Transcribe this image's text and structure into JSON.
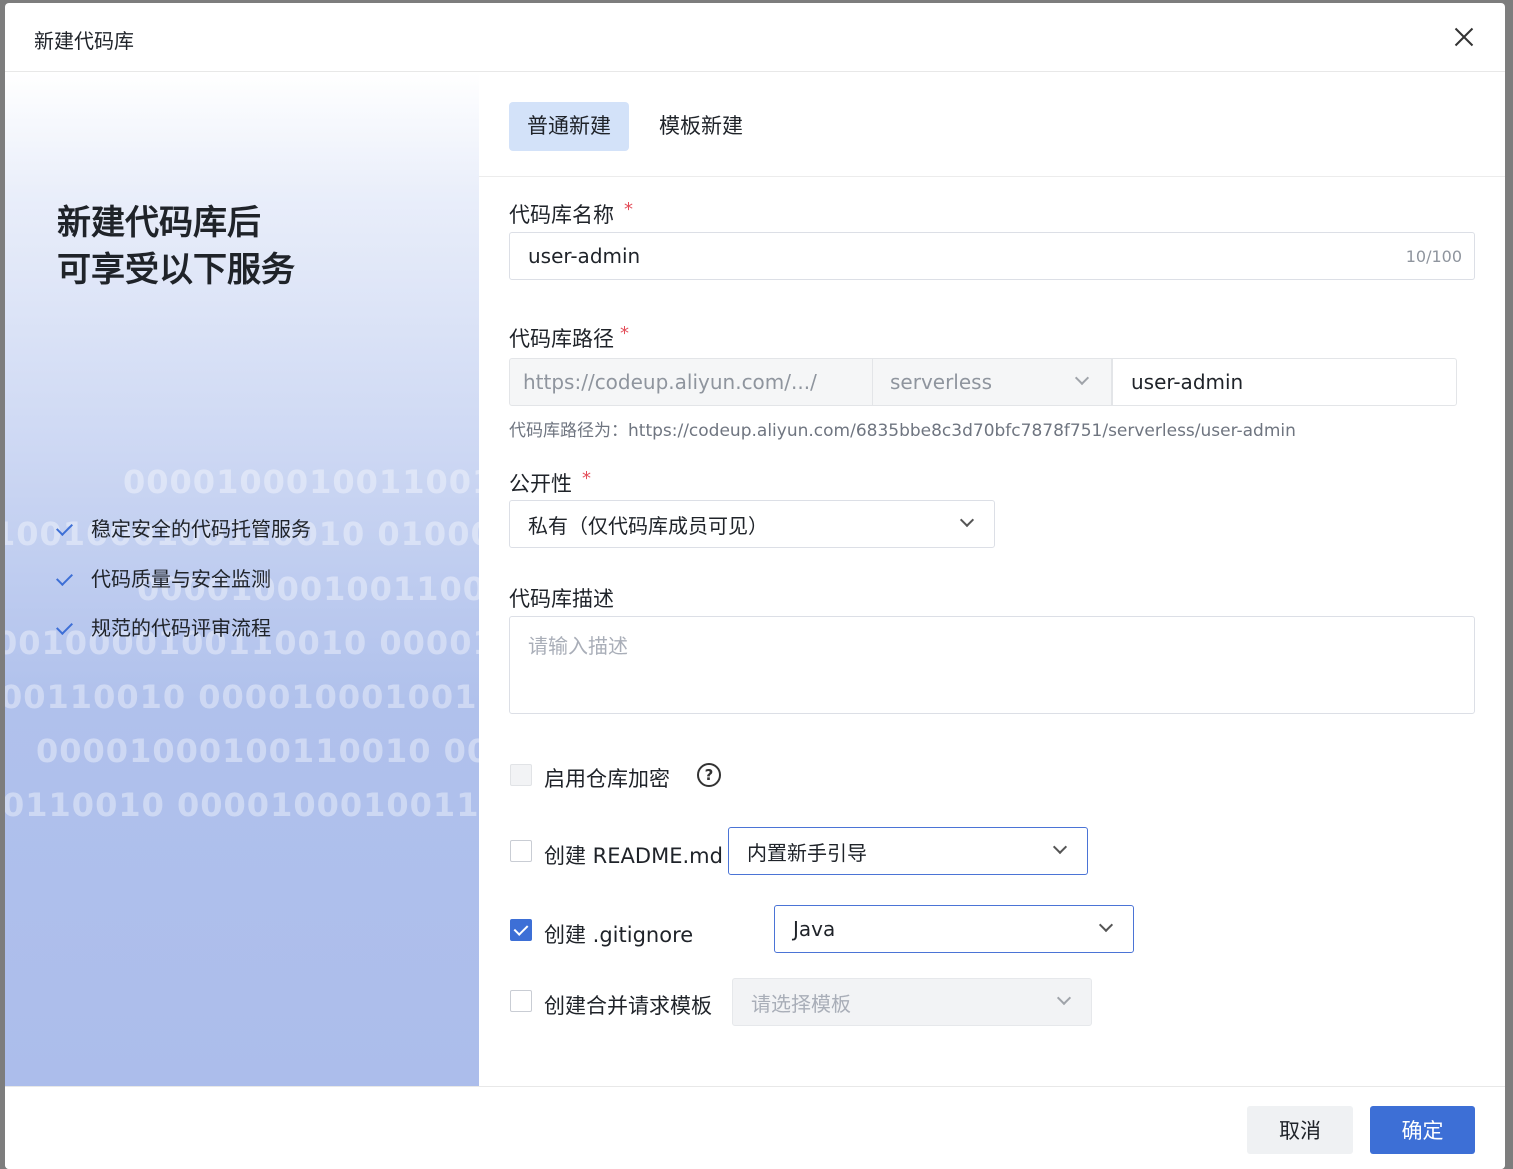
{
  "dialog": {
    "title": "新建代码库"
  },
  "promo": {
    "title_line1": "新建代码库后",
    "title_line2": "可享受以下服务",
    "features": [
      "稳定安全的代码托管服务",
      "代码质量与安全监测",
      "规范的代码评审流程"
    ],
    "binary_rows": [
      "0000100010011001​0",
      "1001000100110010  0000100010010011",
      "00001000100110010",
      "0010000100110010   00001000100110",
      "00110010    000010001001100110",
      "00001000100110010    000010",
      "0110010    0000100010011001"
    ]
  },
  "tabs": [
    {
      "label": "普通新建",
      "active": true
    },
    {
      "label": "模板新建",
      "active": false
    }
  ],
  "form": {
    "name": {
      "label": "代码库名称",
      "required": "*",
      "value": "user-admin",
      "counter": "10/100"
    },
    "path": {
      "label": "代码库路径",
      "required": "*",
      "prefix": "https://codeup.aliyun.com/.../",
      "group": "serverless",
      "value": "user-admin",
      "hint": "代码库路径为：https://codeup.aliyun.com/6835bbe8c3d70bfc7878f751/serverless/user-admin"
    },
    "visibility": {
      "label": "公开性",
      "required": "*",
      "value": "私有（仅代码库成员可见）"
    },
    "description": {
      "label": "代码库描述",
      "placeholder": "请输入描述"
    },
    "encryption": {
      "label": "启用仓库加密",
      "checked": false,
      "disabled": true,
      "help": "?"
    },
    "readme": {
      "label": "创建 README.md",
      "checked": false,
      "select_value": "内置新手引导"
    },
    "gitignore": {
      "label": "创建 .gitignore",
      "checked": true,
      "select_value": "Java"
    },
    "mr_template": {
      "label": "创建合并请求模板",
      "checked": false,
      "select_placeholder": "请选择模板"
    }
  },
  "footer": {
    "cancel_label": "取消",
    "ok_label": "确定"
  },
  "colors": {
    "primary": "#3d6fd6",
    "tab_active_bg": "#d3e2f9",
    "required": "#e34d59"
  }
}
